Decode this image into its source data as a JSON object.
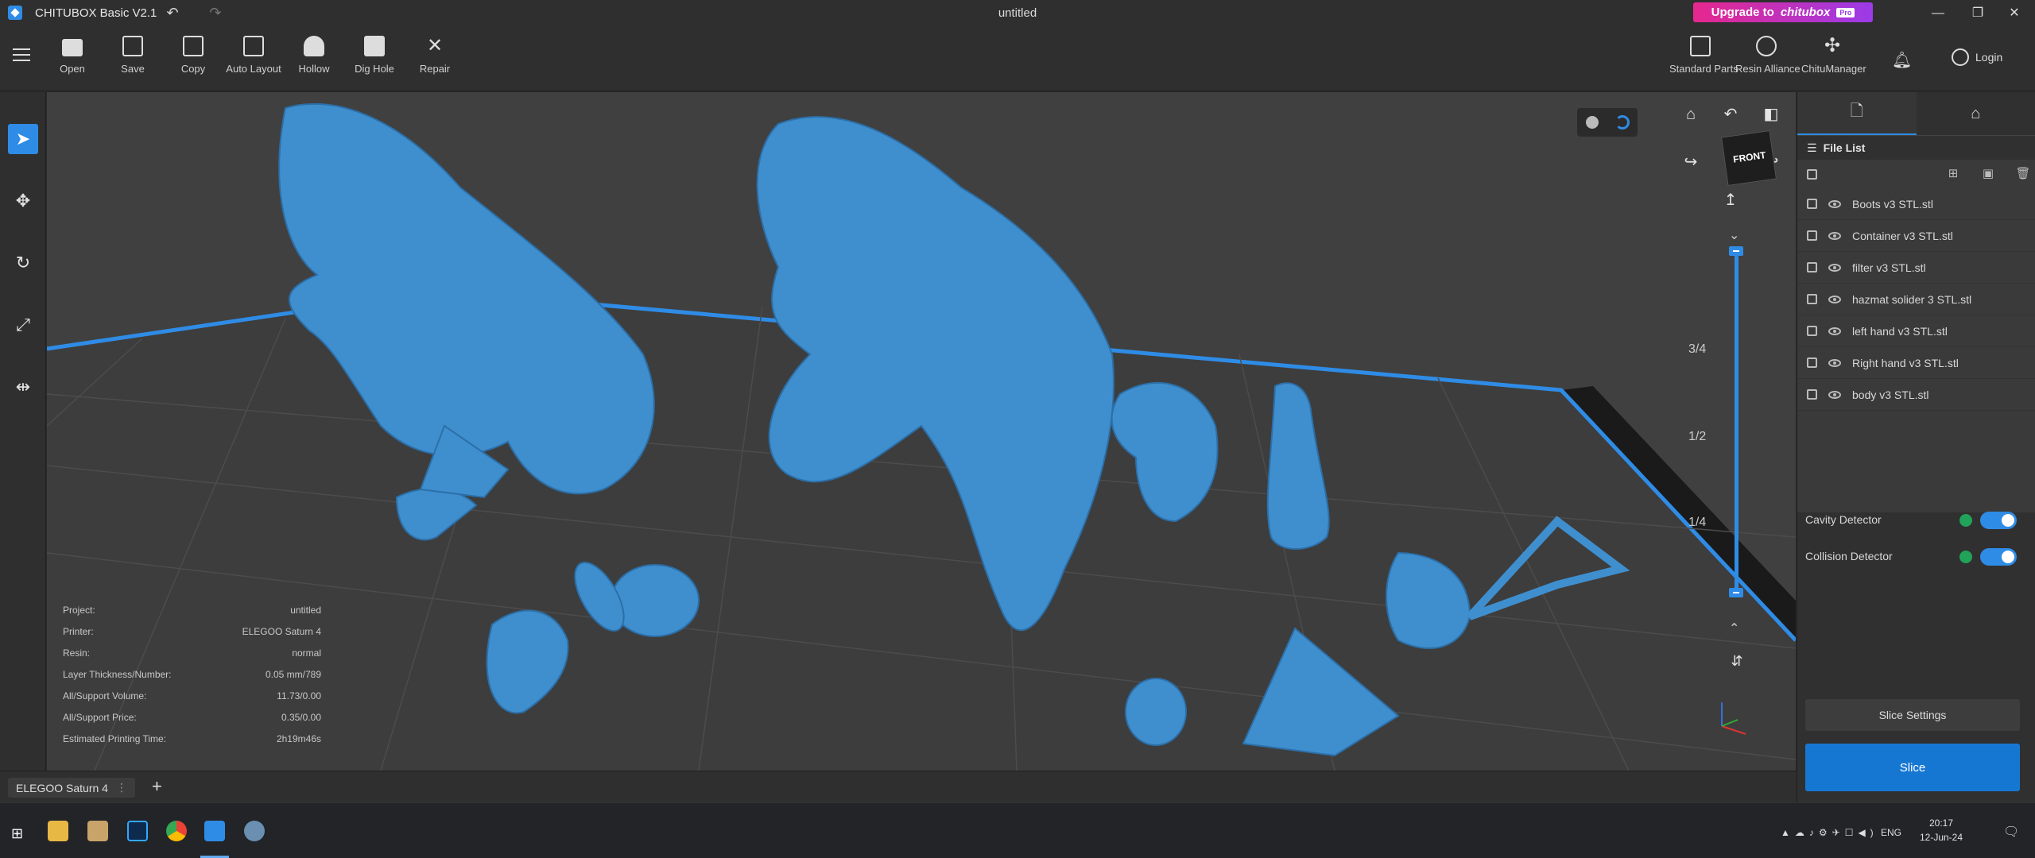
{
  "titlebar": {
    "app_name": "CHITUBOX Basic V2.1",
    "document_title": "untitled",
    "upgrade_prefix": "Upgrade to",
    "upgrade_brand": "chitubox",
    "upgrade_badge": "Pro"
  },
  "toolbar": {
    "left_tools": [
      {
        "label": "Open",
        "icon": "folder-icon"
      },
      {
        "label": "Save",
        "icon": "save-icon"
      },
      {
        "label": "Copy",
        "icon": "copy-icon"
      },
      {
        "label": "Auto Layout",
        "icon": "auto-layout-icon"
      },
      {
        "label": "Hollow",
        "icon": "hollow-icon"
      },
      {
        "label": "Dig Hole",
        "icon": "dig-hole-icon"
      },
      {
        "label": "Repair",
        "icon": "repair-icon"
      }
    ],
    "right_tools": [
      {
        "label": "Standard Parts",
        "icon": "standard-parts-icon"
      },
      {
        "label": "Resin Alliance",
        "icon": "resin-alliance-icon"
      },
      {
        "label": "ChituManager",
        "icon": "chitumanager-icon"
      }
    ],
    "login_label": "Login"
  },
  "viewport": {
    "view_cube_label": "FRONT",
    "layer_fractions": [
      "3/4",
      "1/2",
      "1/4"
    ],
    "info": [
      {
        "label": "Project:",
        "value": "untitled"
      },
      {
        "label": "Printer:",
        "value": "ELEGOO Saturn 4"
      },
      {
        "label": "Resin:",
        "value": "normal"
      },
      {
        "label": "Layer Thickness/Number:",
        "value": "0.05 mm/789"
      },
      {
        "label": "All/Support Volume:",
        "value": "11.73/0.00"
      },
      {
        "label": "All/Support Price:",
        "value": "0.35/0.00"
      },
      {
        "label": "Estimated Printing Time:",
        "value": "2h19m46s"
      }
    ]
  },
  "tabs": {
    "printer_tab": "ELEGOO Saturn 4",
    "add_symbol": "+"
  },
  "right_panel": {
    "file_list_title": "File List",
    "files": [
      "Boots v3 STL.stl",
      "Container v3 STL.stl",
      "filter v3 STL.stl",
      "hazmat solider 3 STL.stl",
      "left hand v3 STL.stl",
      "Right hand v3 STL.stl",
      "body v3 STL.stl"
    ],
    "cavity_detector": "Cavity Detector",
    "collision_detector": "Collision Detector",
    "slice_settings": "Slice Settings",
    "slice": "Slice"
  },
  "taskbar": {
    "lang": "ENG",
    "time": "20:17",
    "date": "12-Jun-24"
  },
  "colors": {
    "accent": "#2f8ce6",
    "model": "#3f8fcf",
    "viewport_bg": "#404040",
    "panel_bg": "#303030"
  }
}
